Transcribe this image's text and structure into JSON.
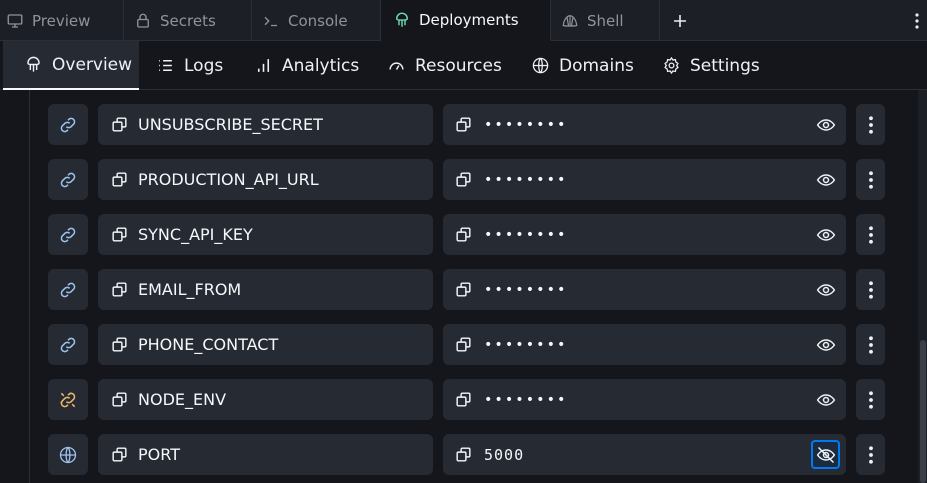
{
  "tabs": [
    {
      "label": "Preview",
      "icon": "monitor-icon"
    },
    {
      "label": "Secrets",
      "icon": "lock-icon"
    },
    {
      "label": "Console",
      "icon": "terminal-icon"
    },
    {
      "label": "Deployments",
      "icon": "deployments-icon",
      "active": true
    },
    {
      "label": "Shell",
      "icon": "shell-icon"
    }
  ],
  "subnav": [
    {
      "label": "Overview",
      "icon": "deployments-icon",
      "active": true
    },
    {
      "label": "Logs",
      "icon": "list-icon"
    },
    {
      "label": "Analytics",
      "icon": "bar-chart-icon"
    },
    {
      "label": "Resources",
      "icon": "gauge-icon"
    },
    {
      "label": "Domains",
      "icon": "globe-icon"
    },
    {
      "label": "Settings",
      "icon": "gear-icon"
    }
  ],
  "secrets": [
    {
      "key": "UNSUBSCRIBE_SECRET",
      "value": "••••••••",
      "link": "linked",
      "visible": false
    },
    {
      "key": "PRODUCTION_API_URL",
      "value": "••••••••",
      "link": "linked",
      "visible": false
    },
    {
      "key": "SYNC_API_KEY",
      "value": "••••••••",
      "link": "linked",
      "visible": false
    },
    {
      "key": "EMAIL_FROM",
      "value": "••••••••",
      "link": "linked",
      "visible": false
    },
    {
      "key": "PHONE_CONTACT",
      "value": "••••••••",
      "link": "linked",
      "visible": false
    },
    {
      "key": "NODE_ENV",
      "value": "••••••••",
      "link": "unlinked",
      "visible": false
    },
    {
      "key": "PORT",
      "value": "5000",
      "link": "global",
      "visible": true
    }
  ],
  "colors": {
    "background": "#14161b",
    "surface": "#262a33",
    "accent": "#0079f2",
    "deployments": "#6ee7b7",
    "warning": "#f0b66d"
  }
}
